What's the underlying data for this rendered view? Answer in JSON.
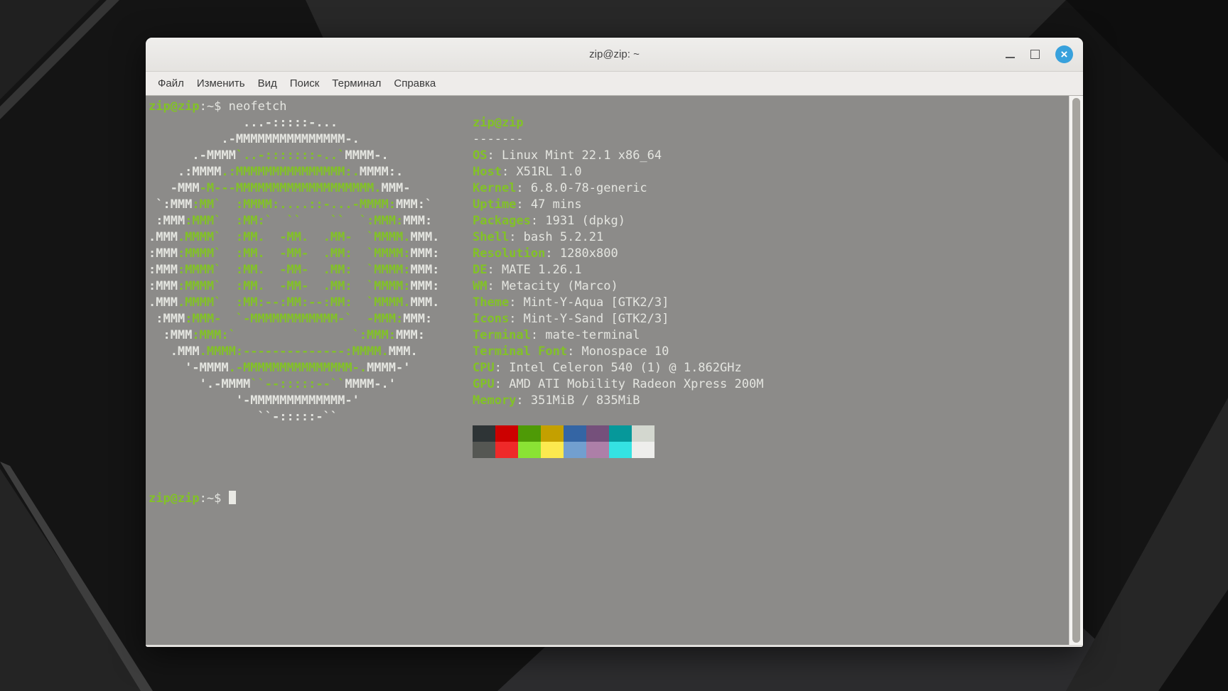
{
  "window": {
    "title": "zip@zip: ~",
    "controls": {
      "minimize_icon": "minimize-icon",
      "maximize_icon": "maximize-icon",
      "close_icon": "close-icon",
      "close_glyph": "×",
      "close_color": "#38a1dc"
    },
    "menu": [
      {
        "name": "file",
        "label": "Файл"
      },
      {
        "name": "edit",
        "label": "Изменить"
      },
      {
        "name": "view",
        "label": "Вид"
      },
      {
        "name": "search",
        "label": "Поиск"
      },
      {
        "name": "terminal",
        "label": "Терминал"
      },
      {
        "name": "help",
        "label": "Справка"
      }
    ]
  },
  "terminal": {
    "colors": {
      "green": "#82c226",
      "white": "#e4e5e0"
    },
    "prompt": {
      "user_host": "zip@zip",
      "colon": ":",
      "path": "~",
      "dollar": "$"
    },
    "command": "neofetch",
    "ascii_art": [
      [
        [
          "w",
          "             ...-:::::-..."
        ]
      ],
      [
        [
          "w",
          "          .-MMMMMMMMMMMMMMM-."
        ]
      ],
      [
        [
          "w",
          "      .-MMMM"
        ],
        [
          "g",
          "`..-:::::::-..`"
        ],
        [
          "w",
          "MMMM-."
        ]
      ],
      [
        [
          "w",
          "    .:MMMM"
        ],
        [
          "g",
          ".:MMMMMMMMMMMMMMM:."
        ],
        [
          "w",
          "MMMM:."
        ]
      ],
      [
        [
          "w",
          "   -MMM"
        ],
        [
          "g",
          "-M---MMMMMMMMMMMMMMMMMMM."
        ],
        [
          "w",
          "MMM-"
        ]
      ],
      [
        [
          "w",
          " `:MMM"
        ],
        [
          "g",
          ":MM`  :MMMM:....::-...-MMMM:"
        ],
        [
          "w",
          "MMM:`"
        ]
      ],
      [
        [
          "w",
          " :MMM"
        ],
        [
          "g",
          ":MMM`  :MM:`  ``    ``  `:MMM:"
        ],
        [
          "w",
          "MMM:"
        ]
      ],
      [
        [
          "w",
          ".MMM"
        ],
        [
          "g",
          ".MMMM`  :MM.  -MM.  .MM-  `MMMM."
        ],
        [
          "w",
          "MMM."
        ]
      ],
      [
        [
          "w",
          ":MMM"
        ],
        [
          "g",
          ":MMMM`  :MM.  -MM-  .MM:  `MMMM:"
        ],
        [
          "w",
          "MMM:"
        ]
      ],
      [
        [
          "w",
          ":MMM"
        ],
        [
          "g",
          ":MMMM`  :MM.  -MM-  .MM:  `MMMM:"
        ],
        [
          "w",
          "MMM:"
        ]
      ],
      [
        [
          "w",
          ":MMM"
        ],
        [
          "g",
          ":MMMM`  :MM.  -MM-  .MM:  `MMMM:"
        ],
        [
          "w",
          "MMM:"
        ]
      ],
      [
        [
          "w",
          ".MMM"
        ],
        [
          "g",
          ".MMMM`  :MM:--:MM:--:MM:  `MMMM."
        ],
        [
          "w",
          "MMM."
        ]
      ],
      [
        [
          "w",
          " :MMM"
        ],
        [
          "g",
          ":MMM-  `-MMMMMMMMMMMM-`  -MMM:"
        ],
        [
          "w",
          "MMM:"
        ]
      ],
      [
        [
          "w",
          "  :MMM"
        ],
        [
          "g",
          ":MMM:`                `:MMM:"
        ],
        [
          "w",
          "MMM:"
        ]
      ],
      [
        [
          "w",
          "   .MMM"
        ],
        [
          "g",
          ".MMMM:--------------:MMMM."
        ],
        [
          "w",
          "MMM."
        ]
      ],
      [
        [
          "w",
          "     '-MMMM"
        ],
        [
          "g",
          ".-MMMMMMMMMMMMMMM-."
        ],
        [
          "w",
          "MMMM-'"
        ]
      ],
      [
        [
          "w",
          "       '.-MMMM"
        ],
        [
          "g",
          "``--:::::--``"
        ],
        [
          "w",
          "MMMM-.'"
        ]
      ],
      [
        [
          "w",
          "            '-MMMMMMMMMMMMM-'"
        ]
      ],
      [
        [
          "w",
          "               ``-:::::-``"
        ]
      ]
    ],
    "info": {
      "title": "zip@zip",
      "underline": "-------",
      "entries": [
        {
          "label": "OS",
          "value": "Linux Mint 22.1 x86_64"
        },
        {
          "label": "Host",
          "value": "X51RL 1.0"
        },
        {
          "label": "Kernel",
          "value": "6.8.0-78-generic"
        },
        {
          "label": "Uptime",
          "value": "47 mins"
        },
        {
          "label": "Packages",
          "value": "1931 (dpkg)"
        },
        {
          "label": "Shell",
          "value": "bash 5.2.21"
        },
        {
          "label": "Resolution",
          "value": "1280x800"
        },
        {
          "label": "DE",
          "value": "MATE 1.26.1"
        },
        {
          "label": "WM",
          "value": "Metacity (Marco)"
        },
        {
          "label": "Theme",
          "value": "Mint-Y-Aqua [GTK2/3]"
        },
        {
          "label": "Icons",
          "value": "Mint-Y-Sand [GTK2/3]"
        },
        {
          "label": "Terminal",
          "value": "mate-terminal"
        },
        {
          "label": "Terminal Font",
          "value": "Monospace 10"
        },
        {
          "label": "CPU",
          "value": "Intel Celeron 540 (1) @ 1.862GHz"
        },
        {
          "label": "GPU",
          "value": "AMD ATI Mobility Radeon Xpress 200M"
        },
        {
          "label": "Memory",
          "value": "351MiB / 835MiB"
        }
      ]
    },
    "palette": {
      "row1": [
        "#2e3436",
        "#cc0000",
        "#4e9a06",
        "#c4a000",
        "#3465a4",
        "#75507b",
        "#06989a",
        "#d3d7cf"
      ],
      "row2": [
        "#555753",
        "#ef2929",
        "#8ae234",
        "#fce94f",
        "#729fcf",
        "#ad7fa8",
        "#34e2e2",
        "#eeeeec"
      ]
    }
  }
}
